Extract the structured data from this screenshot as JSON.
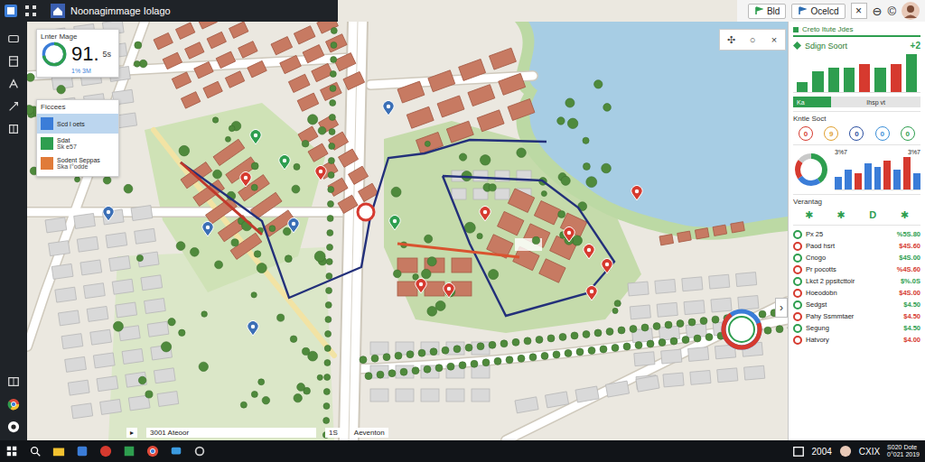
{
  "window": {
    "title": "Noonagimmage Iolago"
  },
  "topbar": {
    "buttons": [
      {
        "label": "Bld",
        "color": "#2e9e4f"
      },
      {
        "label": "Ocelcd",
        "color": "#2b6cb0"
      }
    ],
    "close": "×",
    "icons": [
      "⊖",
      "©"
    ]
  },
  "map_card": {
    "title": "Lnter Mage",
    "value": "91.",
    "unit": "5s",
    "sub": "1% 3M",
    "level": 0.72
  },
  "filters": {
    "title": "Ficcees",
    "items": [
      {
        "label": "Scd l oets",
        "selected": true,
        "color": "#3b7dd8"
      },
      {
        "label": "Sdat",
        "sub": "Sk e57",
        "selected": false,
        "color": "#2e9e4f"
      },
      {
        "label": "Sodent Seppas",
        "sub": "Ska I°odde",
        "selected": false,
        "color": "#e07b39"
      }
    ]
  },
  "map_controls": {
    "buttons": [
      "✣",
      "○",
      "×"
    ],
    "side_toggle": "›"
  },
  "pins": [
    {
      "color": "#d63a2f"
    },
    {
      "color": "#d63a2f"
    },
    {
      "color": "#d63a2f"
    },
    {
      "color": "#d63a2f"
    },
    {
      "color": "#d63a2f"
    },
    {
      "color": "#d63a2f"
    },
    {
      "color": "#d63a2f"
    },
    {
      "color": "#d63a2f"
    },
    {
      "color": "#d63a2f"
    },
    {
      "color": "#d63a2f"
    },
    {
      "color": "#2e9e4f"
    },
    {
      "color": "#2e9e4f"
    },
    {
      "color": "#2e9e4f"
    },
    {
      "color": "#3b6fb6"
    },
    {
      "color": "#3b6fb6"
    },
    {
      "color": "#3b6fb6"
    },
    {
      "color": "#3b6fb6"
    },
    {
      "color": "#3b6fb6"
    }
  ],
  "gauge": {
    "level": 0.7
  },
  "map_footer": {
    "marker": "▸",
    "address": "3001 Ateoor",
    "count": "1S",
    "place": "Aeventon"
  },
  "side_panel": {
    "header": "Creto Itute Jdes",
    "signal": {
      "title": "Sdign Soort",
      "delta": "+2",
      "bars": [
        {
          "value": 3,
          "color": "#2e9e4f"
        },
        {
          "value": 6,
          "color": "#2e9e4f"
        },
        {
          "value": 7,
          "color": "#2e9e4f"
        },
        {
          "value": 7,
          "color": "#2e9e4f"
        },
        {
          "value": 8,
          "color": "#d63a2f"
        },
        {
          "value": 7,
          "color": "#2e9e4f"
        },
        {
          "value": 8,
          "color": "#d63a2f"
        },
        {
          "value": 11,
          "color": "#2e9e4f"
        }
      ]
    },
    "slider": {
      "left": "Ka",
      "right": "Ihsp vt",
      "level": 0.3
    },
    "kntle": {
      "title": "Kntle Soct",
      "items": [
        {
          "text": "0",
          "color": "#d63a2f"
        },
        {
          "text": "9",
          "color": "#e0a030"
        },
        {
          "text": "0",
          "color": "#2b4fa0"
        },
        {
          "text": "0",
          "color": "#3b8fd8"
        },
        {
          "text": "0",
          "color": "#2e9e4f"
        }
      ]
    },
    "summary": {
      "left": "3%7",
      "right": "3%7",
      "donut": [
        {
          "value": 40,
          "color": "#2e9e4f"
        },
        {
          "value": 25,
          "color": "#3b7dd8"
        },
        {
          "value": 20,
          "color": "#d63a2f"
        },
        {
          "value": 15,
          "color": "#c9c9c9"
        }
      ],
      "bars": [
        {
          "value": 4,
          "color": "#3b7dd8"
        },
        {
          "value": 6,
          "color": "#3b7dd8"
        },
        {
          "value": 5,
          "color": "#d63a2f"
        },
        {
          "value": 8,
          "color": "#3b7dd8"
        },
        {
          "value": 7,
          "color": "#3b7dd8"
        },
        {
          "value": 9,
          "color": "#d63a2f"
        },
        {
          "value": 6,
          "color": "#3b7dd8"
        },
        {
          "value": 10,
          "color": "#d63a2f"
        },
        {
          "value": 5,
          "color": "#3b7dd8"
        }
      ]
    },
    "verantag": {
      "title": "Verantag",
      "icons": [
        "✱",
        "✱",
        "D",
        "✱"
      ]
    },
    "list": [
      {
        "name": "Px 25",
        "value": "%5S.80",
        "color": "#2e9e4f"
      },
      {
        "name": "Paod hsrt",
        "value": "$4S.60",
        "color": "#d63a2f"
      },
      {
        "name": "Cnogo",
        "value": "$4S.00",
        "color": "#2e9e4f"
      },
      {
        "name": "Pr pocotts",
        "value": "%4S.60",
        "color": "#d63a2f"
      },
      {
        "name": "Lkct 2 ppsitcttoir",
        "value": "$%.0S",
        "color": "#2e9e4f"
      },
      {
        "name": "Hoeodobn",
        "value": "$4S.00",
        "color": "#d63a2f"
      },
      {
        "name": "Sedgst",
        "value": "$4.50",
        "color": "#2e9e4f"
      },
      {
        "name": "Pahy Ssmmtaer",
        "value": "$4.50",
        "color": "#d63a2f"
      },
      {
        "name": "Segung",
        "value": "$4.50",
        "color": "#2e9e4f"
      },
      {
        "name": "Hatvory",
        "value": "$4.00",
        "color": "#d63a2f"
      }
    ]
  },
  "taskbar": {
    "time": "2004",
    "label": "CXIX",
    "date": [
      "S020 Dote",
      "0°021 2019"
    ]
  }
}
